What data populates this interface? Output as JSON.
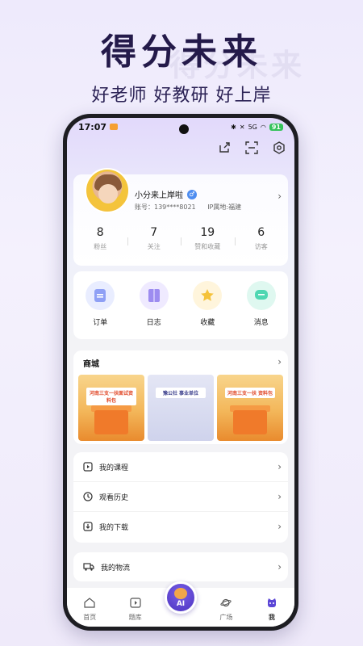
{
  "promo": {
    "headline": "得分未来",
    "subline": "好老师 好教研 好上岸"
  },
  "statusbar": {
    "time": "17:07",
    "signal": "5G",
    "battery": "91"
  },
  "profile": {
    "username": "小分来上岸啦",
    "account": "账号：139****8021",
    "ip": "IP属地:福建"
  },
  "stats": [
    {
      "value": "8",
      "label": "粉丝"
    },
    {
      "value": "7",
      "label": "关注"
    },
    {
      "value": "19",
      "label": "赞和收藏"
    },
    {
      "value": "6",
      "label": "访客"
    }
  ],
  "quick_actions": [
    {
      "label": "订单",
      "color": "#8fa0f5"
    },
    {
      "label": "日志",
      "color": "#9d8cf0"
    },
    {
      "label": "收藏",
      "color": "#f5c23a"
    },
    {
      "label": "消息",
      "color": "#4fd7b2"
    }
  ],
  "shop": {
    "title": "商城",
    "items": [
      {
        "tag": "河南三支一扶面试资料包"
      },
      {
        "tag": "豫公社 事业单位"
      },
      {
        "tag": "河南三支一扶 资料包"
      }
    ]
  },
  "menu": [
    {
      "label": "我的课程"
    },
    {
      "label": "观看历史"
    },
    {
      "label": "我的下载"
    }
  ],
  "logistics": {
    "label": "我的物流"
  },
  "tabs": [
    {
      "label": "首页"
    },
    {
      "label": "题库"
    },
    {
      "label": "广场"
    },
    {
      "label": "我"
    }
  ],
  "ai_label": "AI"
}
